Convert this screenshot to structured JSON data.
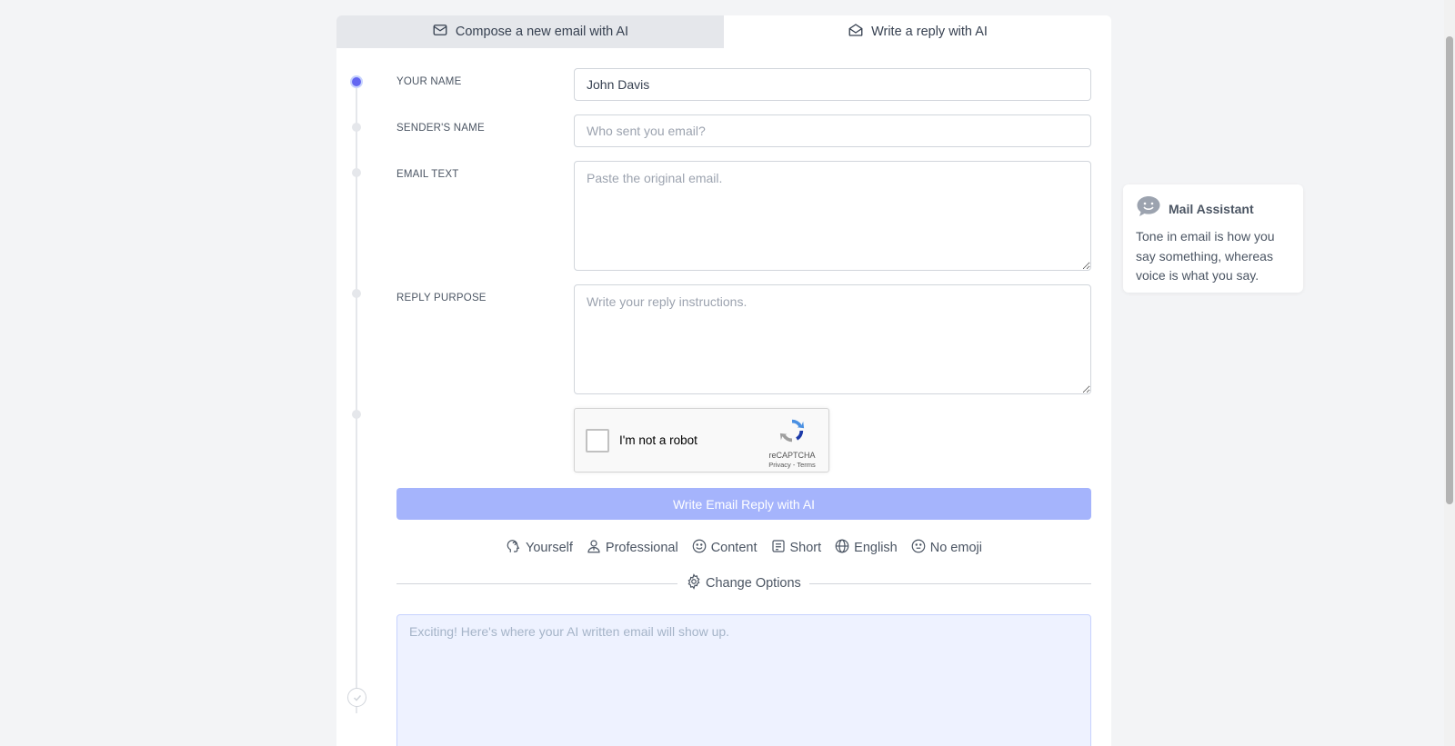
{
  "tabs": [
    {
      "label": "Compose a new email with AI",
      "icon": "envelope-icon",
      "active": false
    },
    {
      "label": "Write a reply with AI",
      "icon": "envelope-open-icon",
      "active": true
    }
  ],
  "form": {
    "your_name": {
      "label": "YOUR NAME",
      "value": "John Davis",
      "placeholder": ""
    },
    "sender_name": {
      "label": "SENDER'S NAME",
      "value": "",
      "placeholder": "Who sent you email?"
    },
    "email_text": {
      "label": "EMAIL TEXT",
      "value": "",
      "placeholder": "Paste the original email."
    },
    "reply_purpose": {
      "label": "REPLY PURPOSE",
      "value": "",
      "placeholder": "Write your reply instructions."
    }
  },
  "recaptcha": {
    "label": "I'm not a robot",
    "brand": "reCAPTCHA",
    "links": "Privacy - Terms"
  },
  "submit_label": "Write Email Reply with AI",
  "options": [
    {
      "label": "Yourself",
      "icon": "head-icon"
    },
    {
      "label": "Professional",
      "icon": "person-icon"
    },
    {
      "label": "Content",
      "icon": "smile-icon"
    },
    {
      "label": "Short",
      "icon": "document-icon"
    },
    {
      "label": "English",
      "icon": "globe-icon"
    },
    {
      "label": "No emoji",
      "icon": "neutral-face-icon"
    }
  ],
  "change_options_label": "Change Options",
  "output": {
    "placeholder": "Exciting! Here's where your AI written email will show up."
  },
  "assistant": {
    "title": "Mail Assistant",
    "tip": "Tone in email is how you say something, whereas voice is what you say."
  },
  "colors": {
    "accent": "#6366f1",
    "button": "#a5b4fc",
    "output_bg": "#eef2ff",
    "page_bg": "#f3f4f6"
  }
}
